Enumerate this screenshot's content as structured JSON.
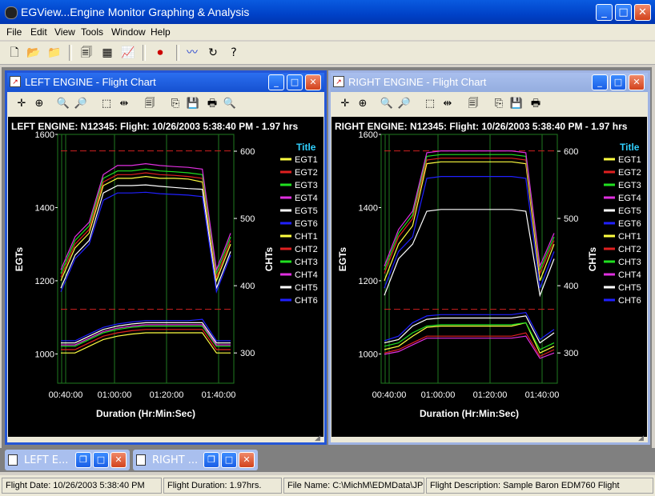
{
  "app": {
    "title": "EGView...Engine Monitor Graphing & Analysis"
  },
  "menu": [
    "File",
    "Edit",
    "View",
    "Tools",
    "Window",
    "Help"
  ],
  "left": {
    "window_title": "LEFT ENGINE - Flight Chart",
    "chart_title": "LEFT ENGINE: N12345:  Flight: 10/26/2003 5:38:40 PM - 1.97 hrs"
  },
  "right": {
    "window_title": "RIGHT ENGINE - Flight Chart",
    "chart_title": "RIGHT ENGINE: N12345:  Flight: 10/26/2003 5:38:40 PM - 1.97 hrs"
  },
  "taskbar": {
    "left_label": "LEFT E...",
    "right_label": "RIGHT ..."
  },
  "status": {
    "flight_date": "Flight Date: 10/26/2003 5:38:40 PM",
    "flight_duration": "Flight Duration: 1.97hrs.",
    "file_name": "File Name: C:\\MichM\\EDMData\\JPI Tv",
    "flight_description": "Flight Description: Sample Baron EDM760 Flight"
  },
  "colors": {
    "egt1": "#ffff40",
    "egt2": "#e02020",
    "egt3": "#20e020",
    "egt4": "#e030e0",
    "egt5": "#ffffff",
    "egt6": "#2020ff"
  },
  "chart_data": [
    {
      "type": "line",
      "title": "LEFT ENGINE: N12345:  Flight: 10/26/2003 5:38:40 PM - 1.97 hrs",
      "xlabel": "Duration (Hr:Min:Sec)",
      "ylabel": "EGTs",
      "y2label": "CHTs",
      "x_ticks": [
        "00:40:00",
        "01:00:00",
        "01:20:00",
        "01:40:00"
      ],
      "y_ticks": [
        1000,
        1200,
        1400,
        1600
      ],
      "y2_ticks": [
        300,
        400,
        500,
        600
      ],
      "ylim": [
        920,
        1600
      ],
      "y2lim": [
        255,
        625
      ],
      "legend_title": "Title",
      "legend_position": "right",
      "series": [
        {
          "name": "EGT1",
          "color": "#ffff40",
          "axis": "left",
          "values": [
            1200,
            1290,
            1330,
            1460,
            1480,
            1480,
            1485,
            1480,
            1480,
            1478,
            1470,
            1200,
            1300
          ]
        },
        {
          "name": "EGT2",
          "color": "#e02020",
          "axis": "left",
          "values": [
            1210,
            1300,
            1340,
            1470,
            1490,
            1490,
            1495,
            1490,
            1488,
            1485,
            1480,
            1210,
            1310
          ]
        },
        {
          "name": "EGT3",
          "color": "#20e020",
          "axis": "left",
          "values": [
            1220,
            1310,
            1350,
            1480,
            1500,
            1500,
            1505,
            1500,
            1498,
            1495,
            1490,
            1220,
            1320
          ]
        },
        {
          "name": "EGT4",
          "color": "#e030e0",
          "axis": "left",
          "values": [
            1230,
            1320,
            1360,
            1490,
            1515,
            1515,
            1520,
            1515,
            1512,
            1510,
            1505,
            1230,
            1330
          ]
        },
        {
          "name": "EGT5",
          "color": "#ffffff",
          "axis": "left",
          "values": [
            1180,
            1270,
            1310,
            1440,
            1460,
            1460,
            1462,
            1458,
            1455,
            1452,
            1450,
            1180,
            1280
          ]
        },
        {
          "name": "EGT6",
          "color": "#2020ff",
          "axis": "left",
          "values": [
            1170,
            1260,
            1300,
            1420,
            1440,
            1440,
            1442,
            1438,
            1436,
            1434,
            1430,
            1170,
            1270
          ]
        },
        {
          "name": "CHT1",
          "color": "#ffff40",
          "axis": "right",
          "values": [
            300,
            300,
            310,
            320,
            325,
            328,
            330,
            330,
            330,
            330,
            330,
            300,
            300
          ]
        },
        {
          "name": "CHT2",
          "color": "#e02020",
          "axis": "right",
          "values": [
            305,
            305,
            315,
            325,
            330,
            333,
            335,
            335,
            335,
            335,
            335,
            305,
            305
          ]
        },
        {
          "name": "CHT3",
          "color": "#20e020",
          "axis": "right",
          "values": [
            310,
            310,
            320,
            330,
            335,
            338,
            340,
            340,
            340,
            340,
            340,
            310,
            310
          ]
        },
        {
          "name": "CHT4",
          "color": "#e030e0",
          "axis": "right",
          "values": [
            312,
            312,
            322,
            332,
            337,
            340,
            342,
            342,
            342,
            342,
            342,
            312,
            312
          ]
        },
        {
          "name": "CHT5",
          "color": "#ffffff",
          "axis": "right",
          "values": [
            315,
            315,
            325,
            335,
            340,
            343,
            345,
            345,
            345,
            345,
            345,
            315,
            315
          ]
        },
        {
          "name": "CHT6",
          "color": "#2020ff",
          "axis": "right",
          "values": [
            318,
            318,
            328,
            338,
            343,
            346,
            348,
            348,
            348,
            348,
            350,
            318,
            318
          ]
        }
      ]
    },
    {
      "type": "line",
      "title": "RIGHT ENGINE: N12345:  Flight: 10/26/2003 5:38:40 PM - 1.97 hrs",
      "xlabel": "Duration (Hr:Min:Sec)",
      "ylabel": "EGTs",
      "y2label": "CHTs",
      "x_ticks": [
        "00:40:00",
        "01:00:00",
        "01:20:00",
        "01:40:00"
      ],
      "y_ticks": [
        1000,
        1200,
        1400,
        1600
      ],
      "y2_ticks": [
        300,
        400,
        500,
        600
      ],
      "ylim": [
        920,
        1600
      ],
      "y2lim": [
        255,
        625
      ],
      "legend_title": "Title",
      "legend_position": "right",
      "series": [
        {
          "name": "EGT1",
          "color": "#ffff40",
          "axis": "left",
          "values": [
            1200,
            1300,
            1350,
            1520,
            1525,
            1525,
            1525,
            1525,
            1525,
            1525,
            1520,
            1200,
            1300
          ]
        },
        {
          "name": "EGT2",
          "color": "#e02020",
          "axis": "left",
          "values": [
            1220,
            1320,
            1370,
            1530,
            1535,
            1535,
            1535,
            1535,
            1535,
            1535,
            1530,
            1220,
            1310
          ]
        },
        {
          "name": "EGT3",
          "color": "#20e020",
          "axis": "left",
          "values": [
            1230,
            1330,
            1380,
            1540,
            1545,
            1545,
            1545,
            1545,
            1545,
            1545,
            1540,
            1230,
            1320
          ]
        },
        {
          "name": "EGT4",
          "color": "#e030e0",
          "axis": "left",
          "values": [
            1240,
            1340,
            1390,
            1550,
            1555,
            1555,
            1555,
            1555,
            1555,
            1555,
            1550,
            1240,
            1330
          ]
        },
        {
          "name": "EGT5",
          "color": "#ffffff",
          "axis": "left",
          "values": [
            1160,
            1260,
            1300,
            1390,
            1395,
            1395,
            1395,
            1395,
            1395,
            1395,
            1390,
            1160,
            1260
          ]
        },
        {
          "name": "EGT6",
          "color": "#2020ff",
          "axis": "left",
          "values": [
            1180,
            1280,
            1320,
            1480,
            1485,
            1485,
            1485,
            1485,
            1485,
            1485,
            1480,
            1180,
            1280
          ]
        },
        {
          "name": "CHT1",
          "color": "#ffff40",
          "axis": "right",
          "values": [
            305,
            310,
            325,
            338,
            340,
            340,
            340,
            340,
            340,
            340,
            345,
            300,
            310
          ]
        },
        {
          "name": "CHT2",
          "color": "#e02020",
          "axis": "right",
          "values": [
            300,
            305,
            315,
            325,
            325,
            325,
            325,
            325,
            325,
            325,
            330,
            295,
            305
          ]
        },
        {
          "name": "CHT3",
          "color": "#20e020",
          "axis": "right",
          "values": [
            310,
            315,
            330,
            340,
            342,
            342,
            342,
            342,
            342,
            342,
            345,
            305,
            315
          ]
        },
        {
          "name": "CHT4",
          "color": "#e030e0",
          "axis": "right",
          "values": [
            298,
            302,
            312,
            322,
            322,
            322,
            322,
            322,
            322,
            322,
            325,
            292,
            300
          ]
        },
        {
          "name": "CHT5",
          "color": "#ffffff",
          "axis": "right",
          "values": [
            315,
            320,
            340,
            350,
            352,
            352,
            352,
            352,
            352,
            352,
            355,
            315,
            330
          ]
        },
        {
          "name": "CHT6",
          "color": "#2020ff",
          "axis": "right",
          "values": [
            318,
            325,
            345,
            355,
            357,
            357,
            357,
            357,
            357,
            357,
            360,
            320,
            335
          ]
        }
      ]
    }
  ]
}
